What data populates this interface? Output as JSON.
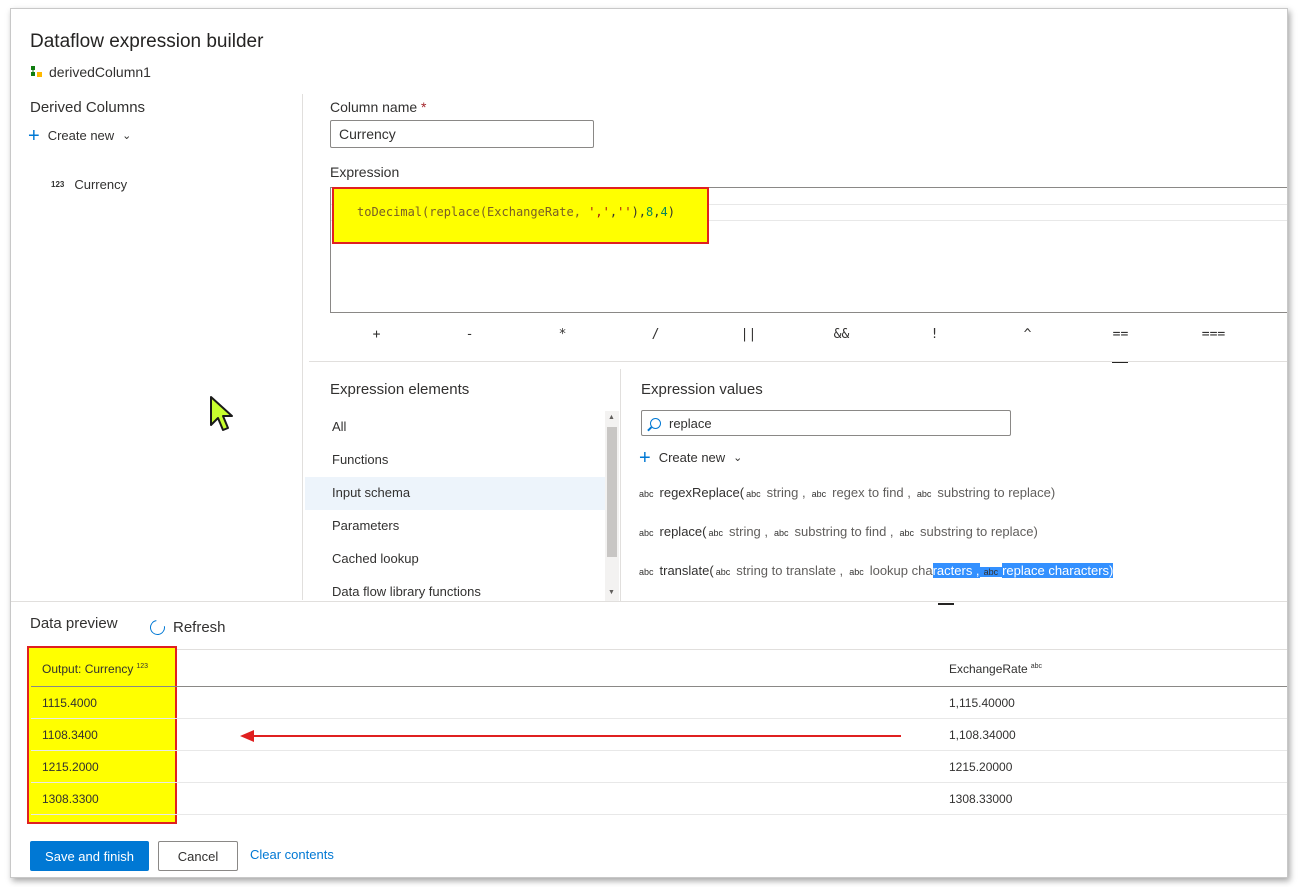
{
  "header": {
    "title": "Dataflow expression builder",
    "subtitle": "derivedColumn1"
  },
  "derived_columns": {
    "heading": "Derived Columns",
    "create_new_label": "Create new",
    "items": [
      {
        "type_tag": "123",
        "name": "Currency"
      }
    ]
  },
  "column_name": {
    "label": "Column name",
    "required_mark": "*",
    "value": "Currency"
  },
  "expression": {
    "label": "Expression",
    "code": {
      "fn": "toDecimal(replace(ExchangeRate, ",
      "str": "','",
      "sep": ",",
      "str2": "''",
      "close": "),",
      "n1": "8",
      "comma": ",",
      "n2": "4",
      "end": ")"
    },
    "operators": [
      "+",
      "-",
      "*",
      "/",
      "||",
      "&&",
      "!",
      "^",
      "==",
      "==="
    ]
  },
  "expression_elements": {
    "heading": "Expression elements",
    "items": [
      "All",
      "Functions",
      "Input schema",
      "Parameters",
      "Cached lookup",
      "Data flow library functions"
    ],
    "selected_index": 2
  },
  "expression_values": {
    "heading": "Expression values",
    "search_value": "replace",
    "create_new_label": "Create new",
    "functions": [
      {
        "type_tag": "abc",
        "name": "regexReplace(",
        "params": [
          {
            "type_tag": "abc",
            "text": "string ,"
          },
          {
            "type_tag": "abc",
            "text": "regex to find ,"
          },
          {
            "type_tag": "abc",
            "text": "substring to replace)"
          }
        ]
      },
      {
        "type_tag": "abc",
        "name": "replace(",
        "params": [
          {
            "type_tag": "abc",
            "text": "string ,"
          },
          {
            "type_tag": "abc",
            "text": "substring to find ,"
          },
          {
            "type_tag": "abc",
            "text": "substring to replace)"
          }
        ]
      },
      {
        "type_tag": "abc",
        "name": "translate(",
        "p1_tag": "abc",
        "p1": "string to translate ,",
        "p2_tag": "abc",
        "p2_plain": "lookup cha",
        "p2_sel": "racters ,",
        "p3_tag": "abc",
        "p3_sel": "replace characters)"
      }
    ]
  },
  "data_preview": {
    "heading": "Data preview",
    "refresh_label": "Refresh",
    "columns": [
      {
        "label": "Output: Currency",
        "type_tag": "123"
      },
      {
        "label": "ExchangeRate",
        "type_tag": "abc"
      }
    ],
    "rows": [
      [
        "1115.4000",
        "1,115.40000"
      ],
      [
        "1108.3400",
        "1,108.34000"
      ],
      [
        "1215.2000",
        "1215.20000"
      ],
      [
        "1308.3300",
        "1308.33000"
      ]
    ]
  },
  "footer": {
    "save_label": "Save and finish",
    "cancel_label": "Cancel",
    "clear_label": "Clear contents"
  },
  "colors": {
    "accent": "#0078d4",
    "highlight": "#ffff00",
    "annotation_red": "#e02020"
  }
}
